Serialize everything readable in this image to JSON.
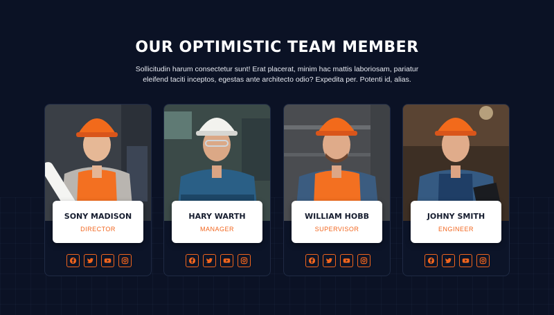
{
  "section": {
    "title": "OUR OPTIMISTIC TEAM MEMBER",
    "description": "Sollicitudin harum consectetur sunt! Erat placerat, minim hac mattis laboriosam, pariatur eleifend taciti inceptos, egestas ante architecto odio? Expedita per. Potenti id, alias."
  },
  "colors": {
    "background": "#0b1225",
    "accent": "#f2651d",
    "card_text": "#151c2e"
  },
  "team": [
    {
      "name": "SONY MADISON",
      "role": "DIRECTOR",
      "photo": "worker-with-blueprint-photo",
      "helmet": "orange-hard-hat"
    },
    {
      "name": "HARY WARTH",
      "role": "MANAGER",
      "photo": "worker-with-goggles-photo",
      "helmet": "white-hard-hat"
    },
    {
      "name": "WILLIAM HOBB",
      "role": "SUPERVISOR",
      "photo": "worker-in-safety-vest-photo",
      "helmet": "orange-hard-hat"
    },
    {
      "name": "JOHNY SMITH",
      "role": "ENGINEER",
      "photo": "worker-with-clipboard-photo",
      "helmet": "orange-hard-hat"
    }
  ],
  "social_icons": [
    "facebook-icon",
    "twitter-icon",
    "youtube-icon",
    "instagram-icon"
  ]
}
